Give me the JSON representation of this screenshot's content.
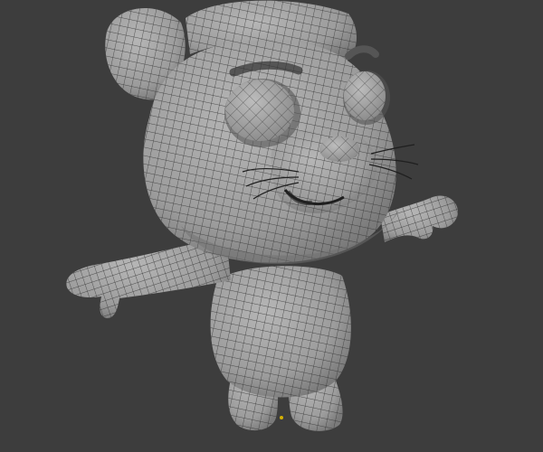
{
  "viewport": {
    "background": "#3d3d3d",
    "shading": "solid",
    "overlay": "wireframe"
  },
  "model": {
    "subject": "cartoon-mouse",
    "mesh_color": "#a7a7a7",
    "wire_color": "#2a2a2a",
    "shadow_color": "#6f6f6f"
  },
  "scene_markers": {
    "origin_color": "#d4b000"
  }
}
